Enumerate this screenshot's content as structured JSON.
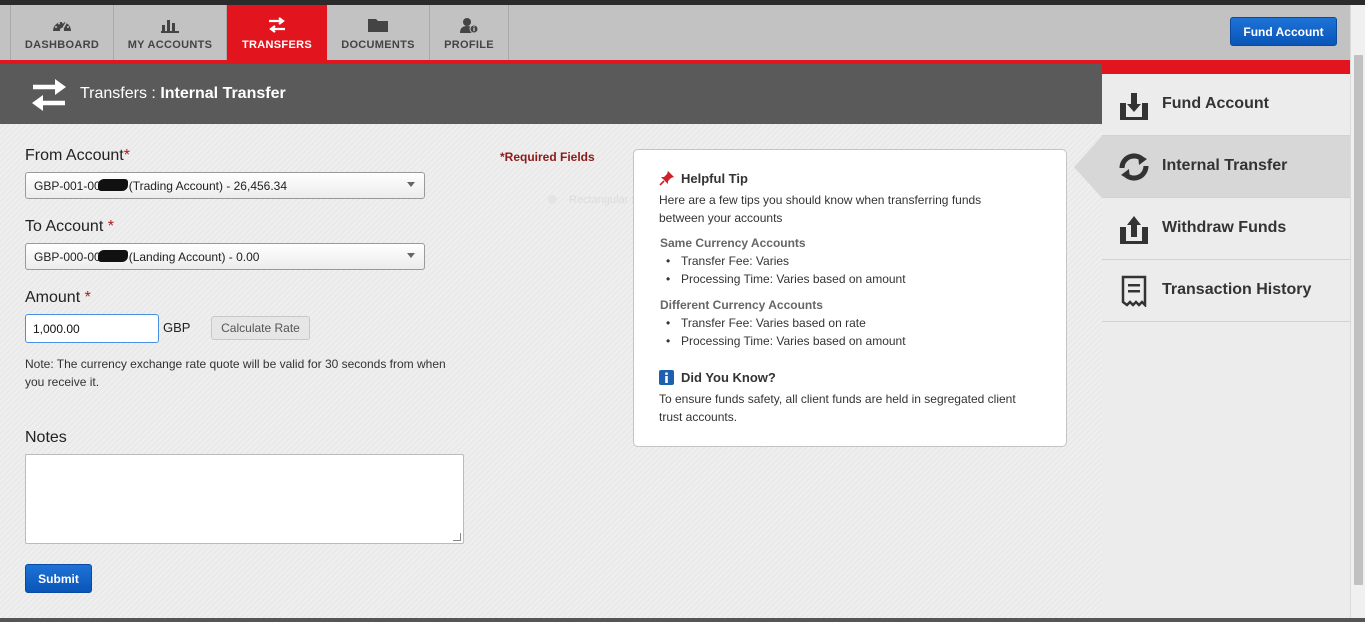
{
  "nav": {
    "tabs": [
      {
        "label": "DASHBOARD",
        "icon": "dashboard-gauge-icon"
      },
      {
        "label": "MY ACCOUNTS",
        "icon": "bar-chart-icon"
      },
      {
        "label": "TRANSFERS",
        "icon": "transfer-arrows-icon",
        "active": true
      },
      {
        "label": "DOCUMENTS",
        "icon": "folder-icon"
      },
      {
        "label": "PROFILE",
        "icon": "user-info-icon"
      }
    ],
    "fund_button": "Fund Account"
  },
  "header": {
    "section": "Transfers",
    "separator": " : ",
    "page": "Internal Transfer",
    "icon": "transfer-arrows-icon"
  },
  "form": {
    "from_label": "From Account",
    "from_req": "*",
    "from_prefix": "GBP-001-00",
    "from_suffix": "(Trading Account) - 26,456.34",
    "to_label": "To Account ",
    "to_req": "*",
    "to_prefix": "GBP-000-00",
    "to_suffix": "(Landing Account) - 0.00",
    "amount_label": "Amount ",
    "amount_req": "*",
    "amount_value": "1,000.00",
    "currency": "GBP",
    "calc_button": "Calculate Rate",
    "note": "Note: The currency exchange rate quote will be valid for 30 seconds from when you receive it.",
    "notes_label": "Notes",
    "submit": "Submit",
    "required_fields": "*Required Fields",
    "ghost_text": "Rectangular Snip"
  },
  "tips": {
    "title": "Helpful Tip",
    "intro": "Here are a few tips you should know when transferring funds between your accounts",
    "same_title": "Same Currency Accounts",
    "same_items": [
      "Transfer Fee: Varies",
      "Processing Time: Varies based on amount"
    ],
    "diff_title": "Different Currency Accounts",
    "diff_items": [
      "Transfer Fee: Varies based on rate",
      "Processing Time: Varies based on amount"
    ],
    "dyk_title": "Did You Know?",
    "dyk_text": "To ensure funds safety, all client funds are held in segregated client trust accounts."
  },
  "sidebar": {
    "items": [
      {
        "label": "Fund Account",
        "icon": "fund-download-icon"
      },
      {
        "label": "Internal Transfer",
        "icon": "internal-transfer-icon",
        "active": true
      },
      {
        "label": "Withdraw Funds",
        "icon": "withdraw-upload-icon"
      },
      {
        "label": "Transaction History",
        "icon": "receipt-history-icon"
      }
    ]
  },
  "colors": {
    "accent_red": "#e2141e",
    "button_blue": "#0a55b8",
    "header_gray": "#5a5a5a",
    "required_red": "#8b1a1a"
  }
}
